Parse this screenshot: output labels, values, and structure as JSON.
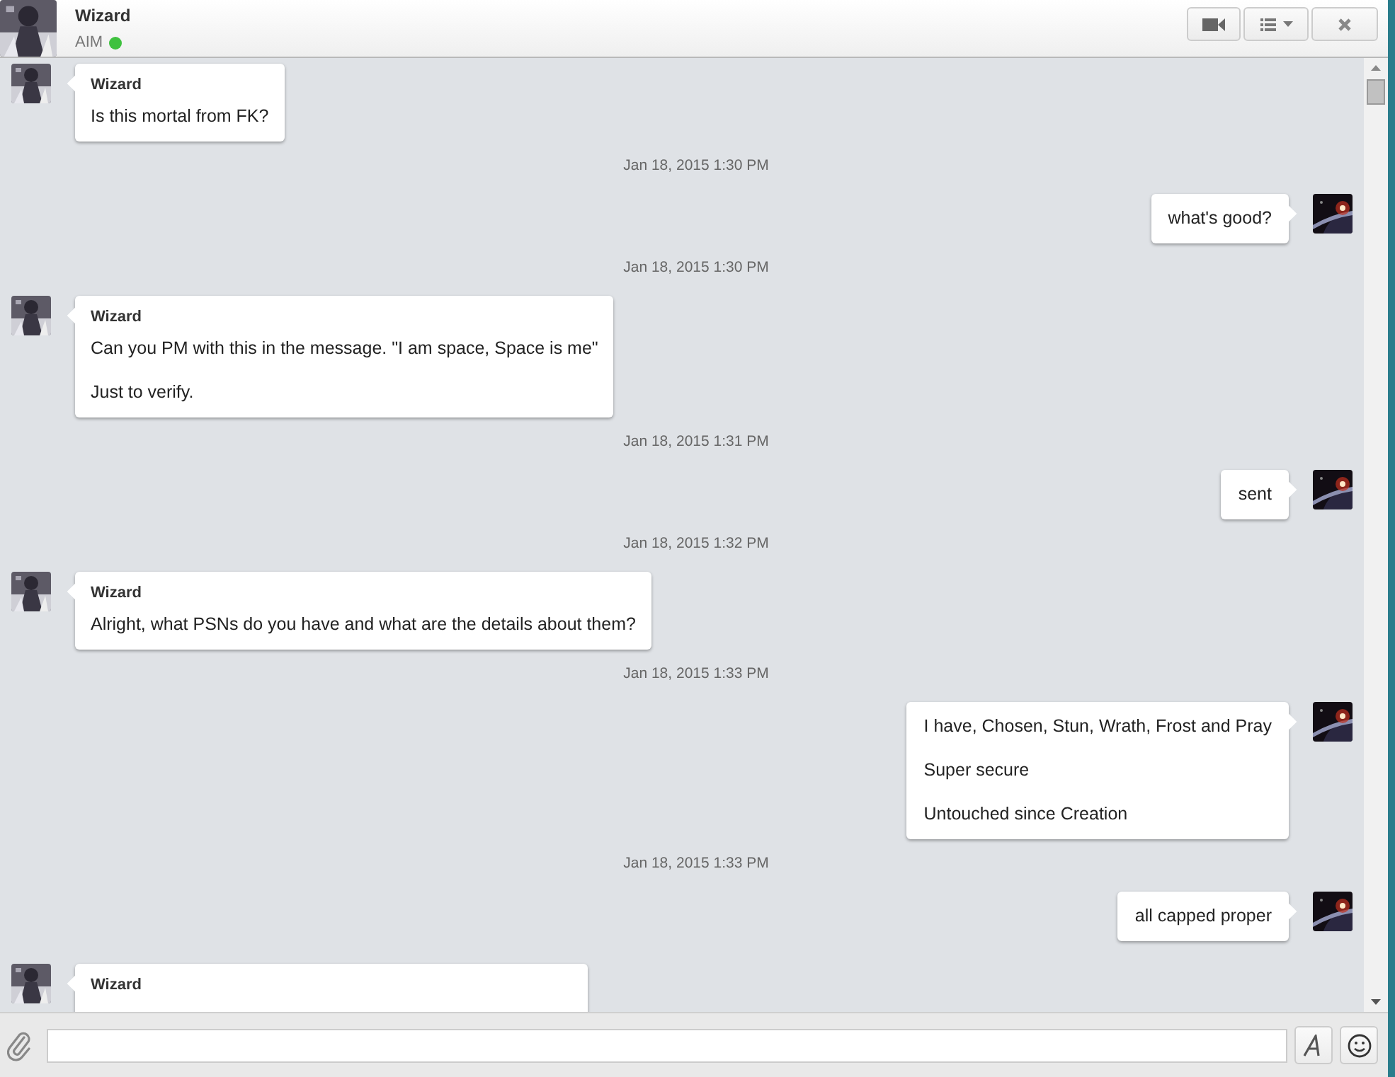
{
  "contact": {
    "name": "Wizard",
    "service": "AIM",
    "online": true
  },
  "messages": [
    {
      "kind": "incoming",
      "sender": "Wizard",
      "paragraphs": [
        "Is this mortal from FK?"
      ]
    },
    {
      "kind": "time",
      "text": "Jan 18, 2015 1:30 PM"
    },
    {
      "kind": "outgoing",
      "paragraphs": [
        "what's good?"
      ]
    },
    {
      "kind": "time",
      "text": "Jan 18, 2015 1:30 PM"
    },
    {
      "kind": "incoming",
      "sender": "Wizard",
      "paragraphs": [
        "Can you PM with this in the message. \"I am space, Space is me\"",
        "Just to verify."
      ]
    },
    {
      "kind": "time",
      "text": "Jan 18, 2015 1:31 PM"
    },
    {
      "kind": "outgoing",
      "paragraphs": [
        "sent"
      ]
    },
    {
      "kind": "time",
      "text": "Jan 18, 2015 1:32 PM"
    },
    {
      "kind": "incoming",
      "sender": "Wizard",
      "paragraphs": [
        "Alright, what PSNs do you have and what are the details about them?"
      ]
    },
    {
      "kind": "time",
      "text": "Jan 18, 2015 1:33 PM"
    },
    {
      "kind": "outgoing",
      "paragraphs": [
        "I have, Chosen, Stun, Wrath, Frost and Pray",
        "Super secure",
        "Untouched since Creation"
      ]
    },
    {
      "kind": "time",
      "text": "Jan 18, 2015 1:33 PM"
    },
    {
      "kind": "outgoing",
      "paragraphs": [
        "all capped proper"
      ]
    },
    {
      "kind": "incoming",
      "sender": "Wizard"
    }
  ]
}
